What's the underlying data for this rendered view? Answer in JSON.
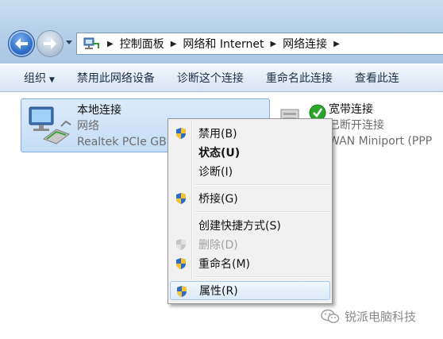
{
  "address": {
    "crumbs": [
      "控制面板",
      "网络和 Internet",
      "网络连接"
    ]
  },
  "toolbar": {
    "items": [
      "组织",
      "禁用此网络设备",
      "诊断这个连接",
      "重命名此连接",
      "查看此连"
    ]
  },
  "connections": [
    {
      "name": "本地连接",
      "status": "网络",
      "device": "Realtek PCIe GB",
      "selected": true
    },
    {
      "name": "宽带连接",
      "status": "已断开连接",
      "device": "WAN Miniport (PPP"
    }
  ],
  "context_menu": {
    "items": [
      {
        "label": "禁用(B)",
        "shield": true
      },
      {
        "label": "状态(U)",
        "bold": true
      },
      {
        "label": "诊断(I)"
      },
      {
        "label": "桥接(G)",
        "shield": true
      },
      {
        "label": "创建快捷方式(S)"
      },
      {
        "label": "删除(D)",
        "shield": true,
        "disabled": true
      },
      {
        "label": "重命名(M)",
        "shield": true
      },
      {
        "label": "属性(R)",
        "shield": true,
        "hover": true
      }
    ]
  },
  "watermark": {
    "text": "锐派电脑科技"
  },
  "colors": {
    "selection": "#c4ddf6",
    "menu_bg": "#f1f1f1",
    "status_ok": "#2aa52a"
  },
  "icons": {
    "back": "back-arrow-icon",
    "forward": "forward-arrow-icon",
    "address": "network-folder-icon",
    "lan": "network-adapter-icon",
    "broadband": "broadband-connection-icon",
    "shield": "uac-shield-icon"
  }
}
